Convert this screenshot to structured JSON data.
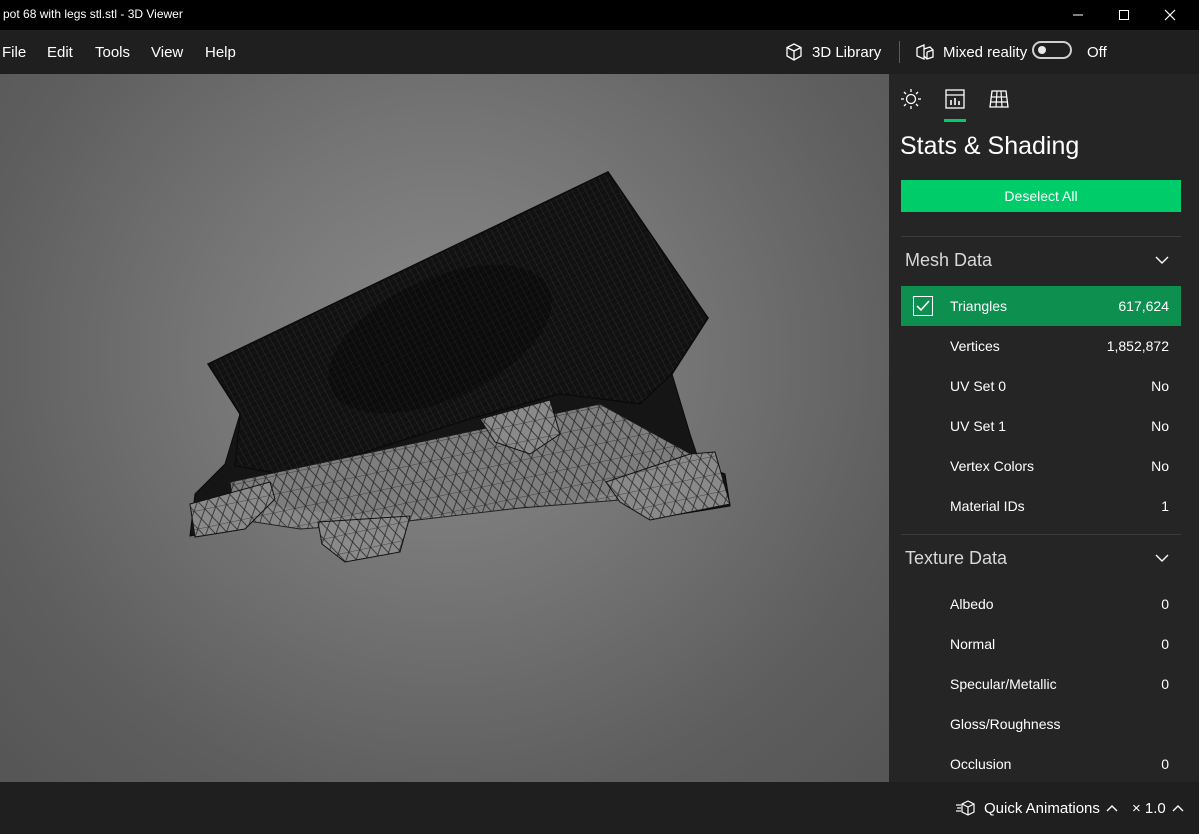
{
  "window": {
    "title": "pot 68 with legs stl.stl - 3D Viewer"
  },
  "menu": {
    "items": [
      "File",
      "Edit",
      "Tools",
      "View",
      "Help"
    ]
  },
  "toolbar": {
    "library_label": "3D Library",
    "mixed_reality_label": "Mixed reality",
    "mixed_reality_state": "Off"
  },
  "panel": {
    "title": "Stats & Shading",
    "tabs": [
      {
        "icon": "sun-icon",
        "active": false
      },
      {
        "icon": "stats-icon",
        "active": true
      },
      {
        "icon": "grid-icon",
        "active": false
      }
    ],
    "deselect_label": "Deselect All",
    "mesh_section": "Mesh Data",
    "mesh_rows": [
      {
        "label": "Triangles",
        "value": "617,624",
        "selected": true
      },
      {
        "label": "Vertices",
        "value": "1,852,872"
      },
      {
        "label": "UV Set 0",
        "value": "No"
      },
      {
        "label": "UV Set 1",
        "value": "No"
      },
      {
        "label": "Vertex Colors",
        "value": "No"
      },
      {
        "label": "Material IDs",
        "value": "1"
      }
    ],
    "texture_section": "Texture Data",
    "texture_rows": [
      {
        "label": "Albedo",
        "value": "0"
      },
      {
        "label": "Normal",
        "value": "0"
      },
      {
        "label": "Specular/Metallic",
        "value": "0"
      },
      {
        "label": "Gloss/Roughness",
        "value": ""
      },
      {
        "label": "Occlusion",
        "value": "0"
      }
    ]
  },
  "bottom": {
    "quick_animations_label": "Quick Animations",
    "speed_label": "× 1.0"
  },
  "colors": {
    "accent": "#00cc6a",
    "selected_row": "#0d8f4f",
    "panel_bg": "#252525",
    "bar_bg": "#1f1f1f"
  }
}
